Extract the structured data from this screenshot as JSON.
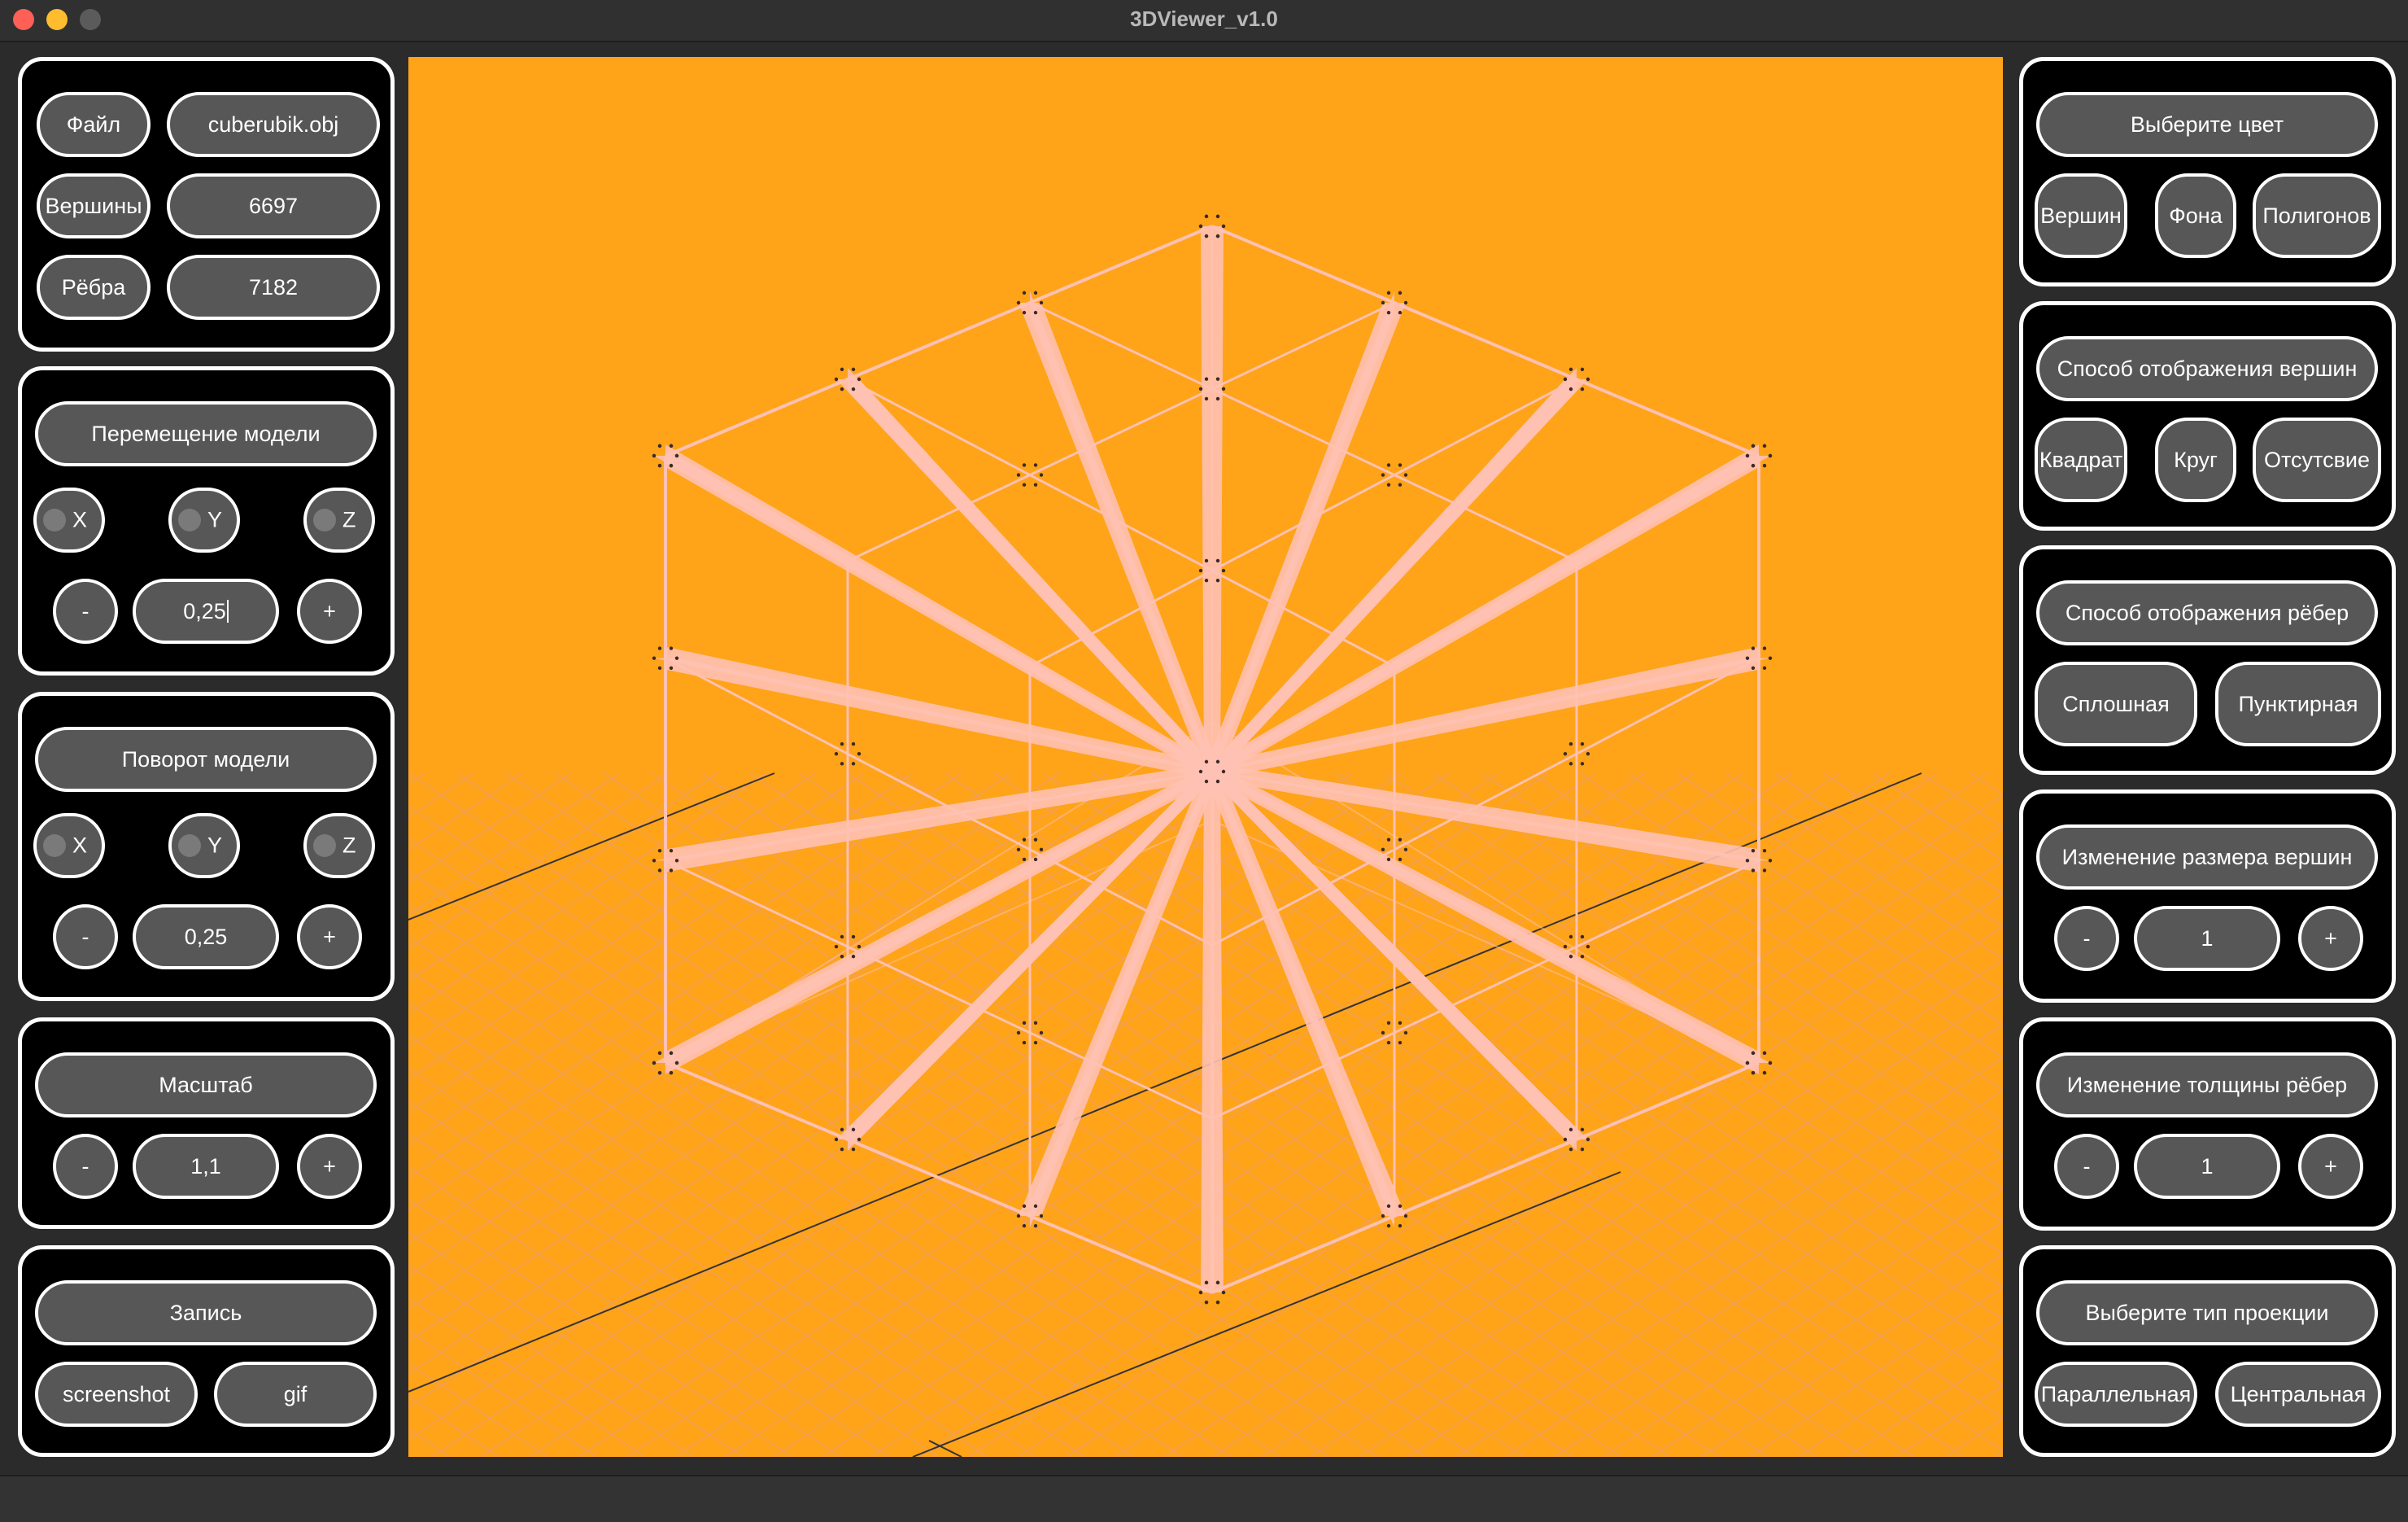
{
  "window": {
    "title": "3DViewer_v1.0"
  },
  "file_panel": {
    "file_button": "Файл",
    "file_name": "cuberubik.obj",
    "vertices_label": "Вершины",
    "vertices_count": "6697",
    "edges_label": "Рёбра",
    "edges_count": "7182"
  },
  "move_panel": {
    "title": "Перемещение модели",
    "axes": [
      "X",
      "Y",
      "Z"
    ],
    "minus": "-",
    "value": "0,25",
    "plus": "+"
  },
  "rotate_panel": {
    "title": "Поворот модели",
    "axes": [
      "X",
      "Y",
      "Z"
    ],
    "minus": "-",
    "value": "0,25",
    "plus": "+"
  },
  "scale_panel": {
    "title": "Масштаб",
    "minus": "-",
    "value": "1,1",
    "plus": "+"
  },
  "record_panel": {
    "title": "Запись",
    "screenshot": "screenshot",
    "gif": "gif"
  },
  "color_panel": {
    "title": "Выберите цвет",
    "vertices": "Вершин",
    "background": "Фона",
    "polygons": "Полигонов"
  },
  "vertex_display_panel": {
    "title": "Способ отображения вершин",
    "square": "Квадрат",
    "circle": "Круг",
    "none": "Отсутсвие"
  },
  "edge_display_panel": {
    "title": "Способ отображения рёбер",
    "solid": "Сплошная",
    "dashed": "Пунктирная"
  },
  "vertex_size_panel": {
    "title": "Изменение размера вершин",
    "minus": "-",
    "value": "1",
    "plus": "+"
  },
  "edge_width_panel": {
    "title": "Изменение толщины рёбер",
    "minus": "-",
    "value": "1",
    "plus": "+"
  },
  "projection_panel": {
    "title": "Выберите тип проекции",
    "parallel": "Параллельная",
    "central": "Центральная"
  },
  "colors": {
    "viewport_background": "#ffa319",
    "model_edges": "#ffc1b3",
    "grid": "#f0a060",
    "panel_background": "#000000",
    "button_background": "#575757"
  }
}
